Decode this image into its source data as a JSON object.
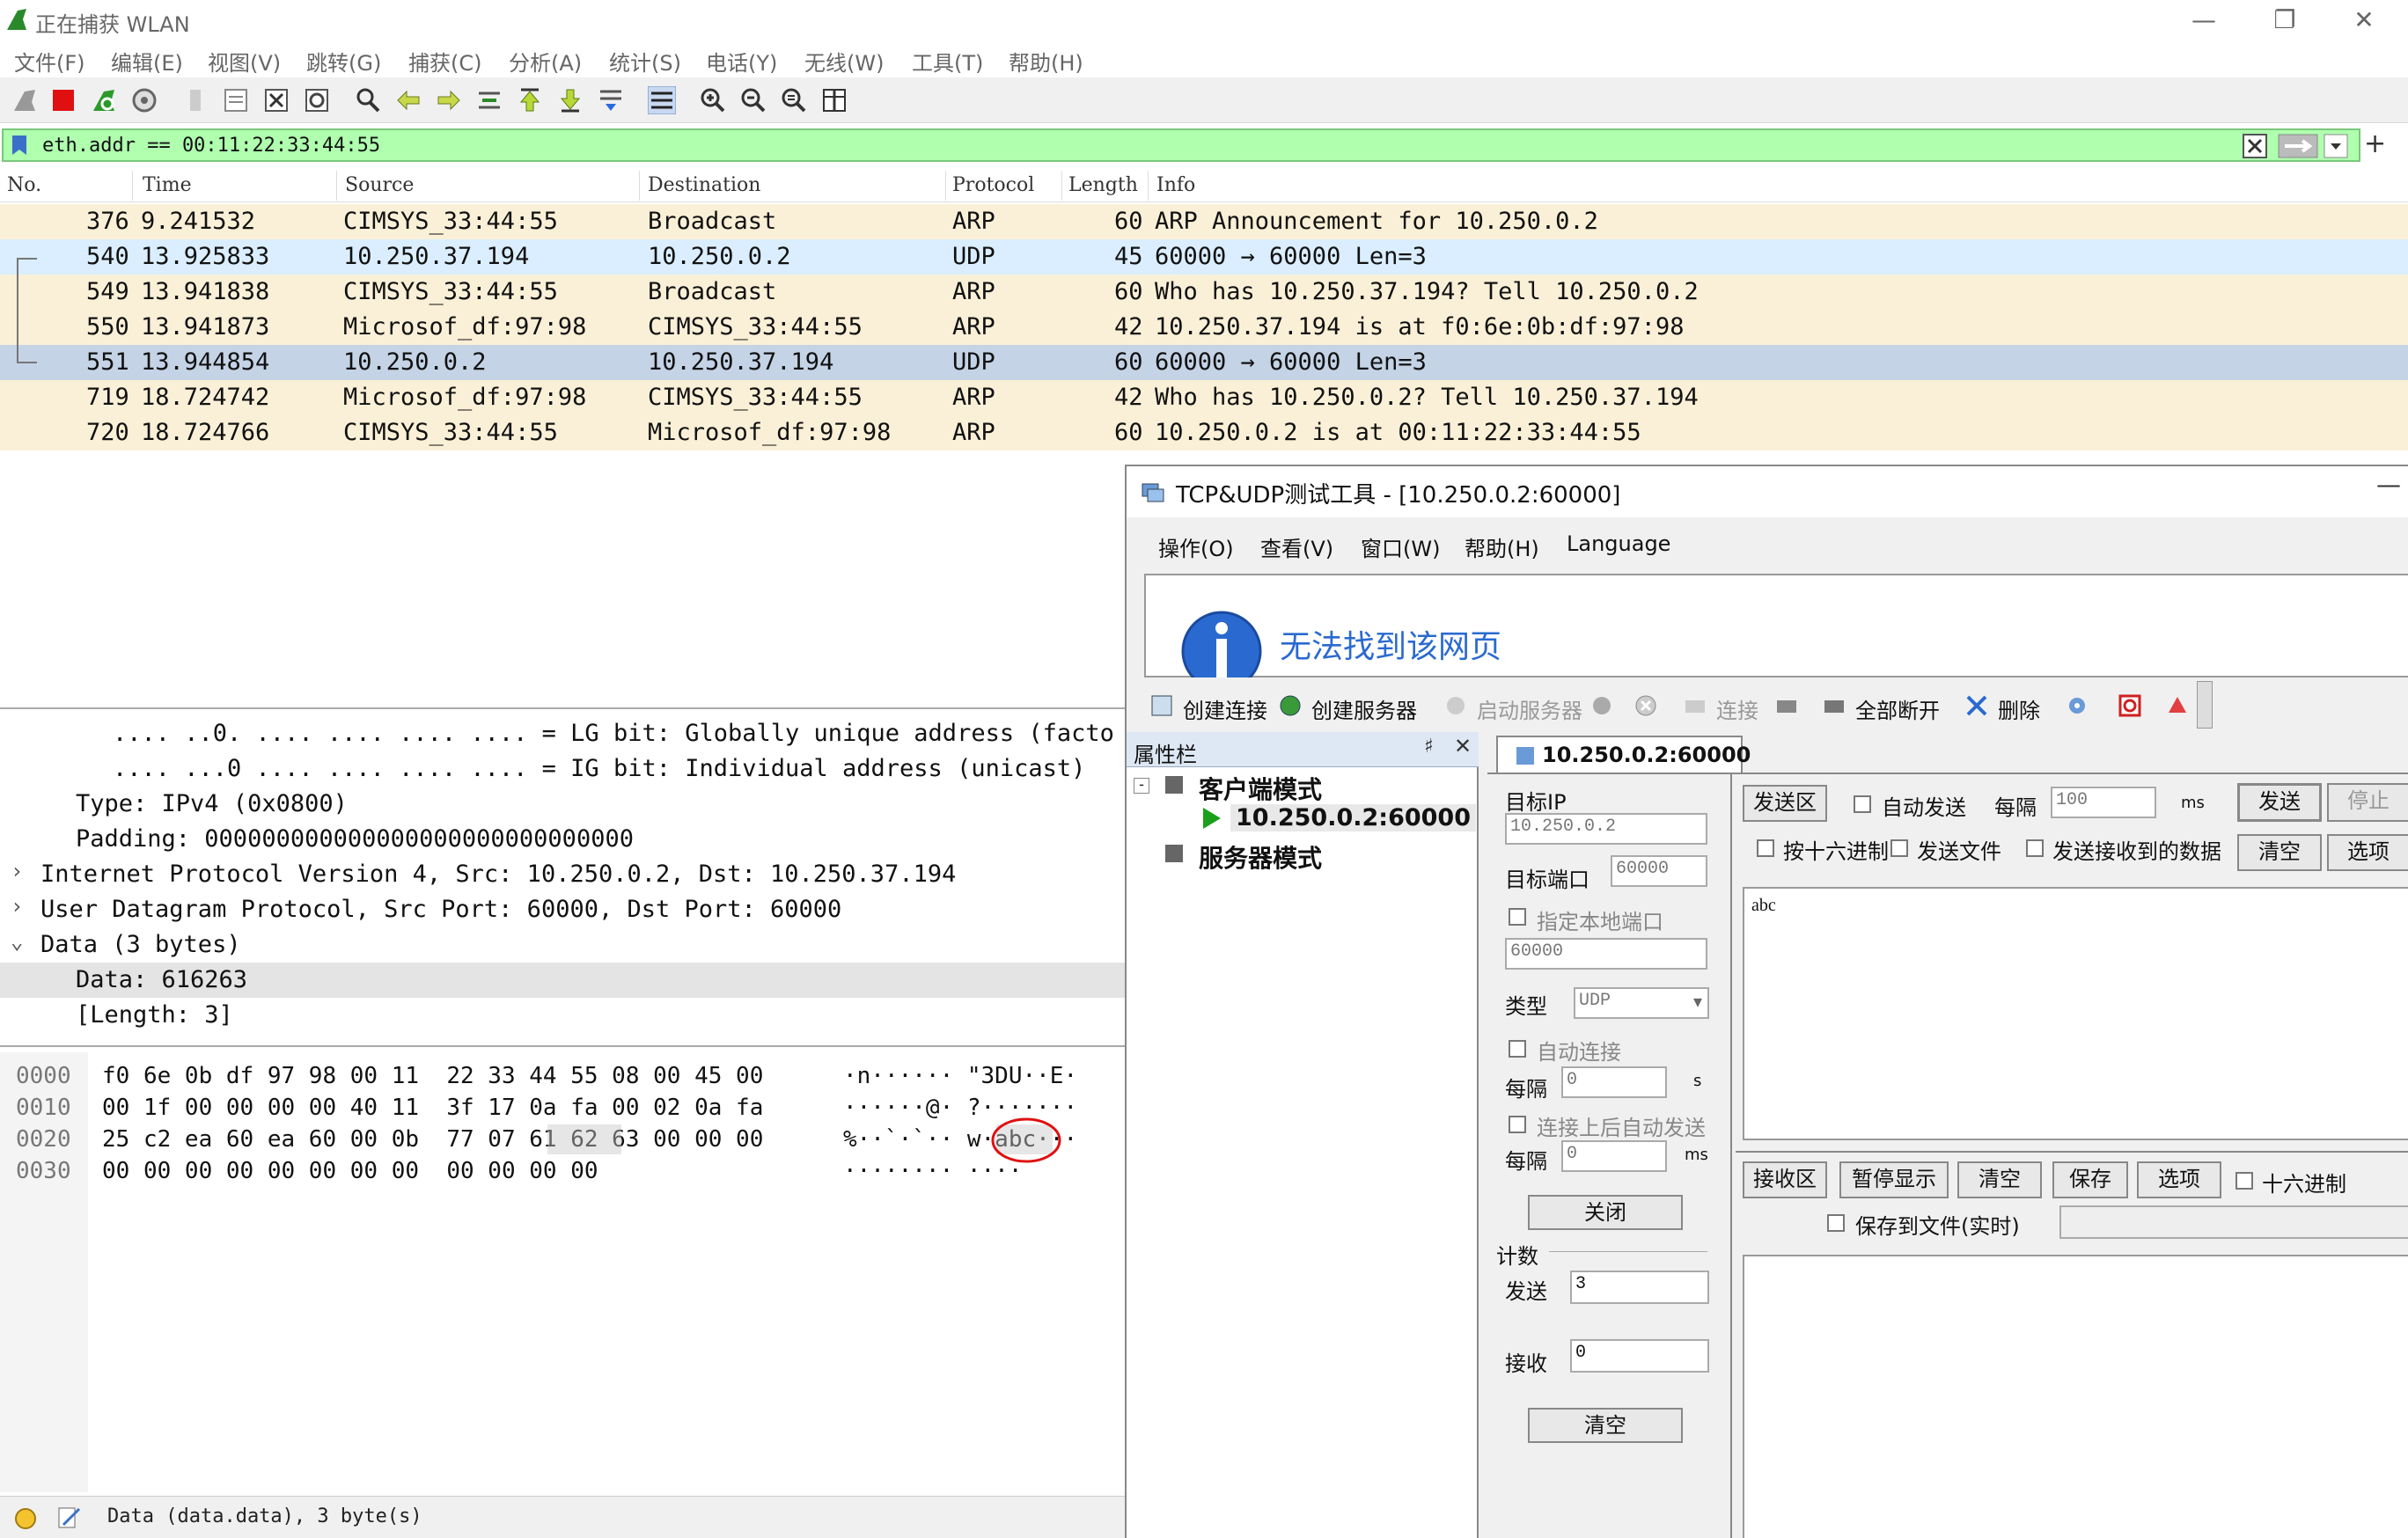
{
  "window": {
    "title": "正在捕获 WLAN"
  },
  "menubar": [
    "文件(F)",
    "编辑(E)",
    "视图(V)",
    "跳转(G)",
    "捕获(C)",
    "分析(A)",
    "统计(S)",
    "电话(Y)",
    "无线(W)",
    "工具(T)",
    "帮助(H)"
  ],
  "filter": {
    "value": "eth.addr == 00:11:22:33:44:55"
  },
  "packet_list": {
    "columns": [
      "No.",
      "Time",
      "Source",
      "Destination",
      "Protocol",
      "Length",
      "Info"
    ],
    "rows": [
      {
        "no": "376",
        "time": "9.241532",
        "src": "CIMSYS_33:44:55",
        "dst": "Broadcast",
        "proto": "ARP",
        "len": "60",
        "info": "ARP Announcement for 10.250.0.2"
      },
      {
        "no": "540",
        "time": "13.925833",
        "src": "10.250.37.194",
        "dst": "10.250.0.2",
        "proto": "UDP",
        "len": "45",
        "info": "60000 → 60000 Len=3"
      },
      {
        "no": "549",
        "time": "13.941838",
        "src": "CIMSYS_33:44:55",
        "dst": "Broadcast",
        "proto": "ARP",
        "len": "60",
        "info": "Who has 10.250.37.194? Tell 10.250.0.2"
      },
      {
        "no": "550",
        "time": "13.941873",
        "src": "Microsof_df:97:98",
        "dst": "CIMSYS_33:44:55",
        "proto": "ARP",
        "len": "42",
        "info": "10.250.37.194 is at f0:6e:0b:df:97:98"
      },
      {
        "no": "551",
        "time": "13.944854",
        "src": "10.250.0.2",
        "dst": "10.250.37.194",
        "proto": "UDP",
        "len": "60",
        "info": "60000 → 60000 Len=3"
      },
      {
        "no": "719",
        "time": "18.724742",
        "src": "Microsof_df:97:98",
        "dst": "CIMSYS_33:44:55",
        "proto": "ARP",
        "len": "42",
        "info": "Who has 10.250.0.2? Tell 10.250.37.194"
      },
      {
        "no": "720",
        "time": "18.724766",
        "src": "CIMSYS_33:44:55",
        "dst": "Microsof_df:97:98",
        "proto": "ARP",
        "len": "60",
        "info": "10.250.0.2 is at 00:11:22:33:44:55"
      }
    ]
  },
  "details": [
    ".... ..0. .... .... .... .... = LG bit: Globally unique address (facto",
    ".... ...0 .... .... .... .... = IG bit: Individual address (unicast)",
    "Type: IPv4 (0x0800)",
    "Padding: 000000000000000000000000000000",
    "Internet Protocol Version 4, Src: 10.250.0.2, Dst: 10.250.37.194",
    "User Datagram Protocol, Src Port: 60000, Dst Port: 60000",
    "Data (3 bytes)",
    "Data: 616263",
    "[Length: 3]"
  ],
  "bytes": [
    {
      "off": "0000",
      "hex": "f0 6e 0b df 97 98 00 11  22 33 44 55 08 00 45 00",
      "ascii": "·n······ \"3DU··E·"
    },
    {
      "off": "0010",
      "hex": "00 1f 00 00 00 00 40 11  3f 17 0a fa 00 02 0a fa",
      "ascii": "······@· ?·······"
    },
    {
      "off": "0020",
      "hex": "25 c2 ea 60 ea 60 00 0b  77 07 61 62 63 00 00 00",
      "ascii": "%··`·`·· w·abc···"
    },
    {
      "off": "0030",
      "hex": "00 00 00 00 00 00 00 00  00 00 00 00",
      "ascii": "········ ····"
    }
  ],
  "status": {
    "text": "Data (data.data), 3 byte(s)"
  },
  "tool": {
    "title": "TCP&UDP测试工具 - [10.250.0.2:60000]",
    "menu": [
      "操作(O)",
      "查看(V)",
      "窗口(W)",
      "帮助(H)",
      "Language"
    ],
    "web_error": "无法找到该网页",
    "toolbar": [
      "创建连接",
      "创建服务器",
      "启动服务器",
      "连接",
      "全部断开",
      "删除"
    ],
    "props_title": "属性栏",
    "tree": {
      "client_mode": "客户端模式",
      "client_item": "10.250.0.2:60000",
      "server_mode": "服务器模式"
    },
    "tab": "10.250.0.2:60000",
    "target_ip_label": "目标IP",
    "target_ip": "10.250.0.2",
    "target_port_label": "目标端口",
    "target_port": "60000",
    "local_port_label": "指定本地端口",
    "local_port": "60000",
    "type_label": "类型",
    "type_value": "UDP",
    "auto_connect_label": "自动连接",
    "interval_label": "每隔",
    "interval_value": "0",
    "interval_unit_s": "s",
    "auto_send_after_label": "连接上后自动发送",
    "interval2_value": "0",
    "interval_unit_ms": "ms",
    "close_btn": "关闭",
    "count_label": "计数",
    "sent_label": "发送",
    "sent_value": "3",
    "recv_label": "接收",
    "recv_value": "0",
    "clear_count_btn": "清空",
    "send_area_label": "发送区",
    "auto_send_label": "自动发送",
    "every_label": "每隔",
    "every_value": "100",
    "every_unit": "ms",
    "send_btn": "发送",
    "stop_btn": "停止",
    "hex_send_label": "按十六进制",
    "send_file_label": "发送文件",
    "send_recv_label": "发送接收到的数据",
    "clear_btn": "清空",
    "options_btn": "选项",
    "send_content": "abc",
    "recv_area_label": "接收区",
    "pause_btn": "暂停显示",
    "recv_clear_btn": "清空",
    "save_btn": "保存",
    "recv_options_btn": "选项",
    "hex_recv_label": "十六进制",
    "save_file_label": "保存到文件(实时)"
  }
}
